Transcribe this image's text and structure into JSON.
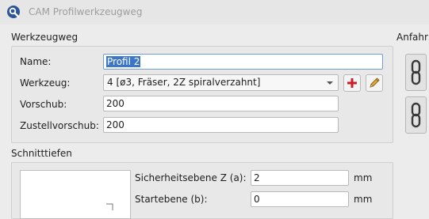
{
  "window": {
    "title": "CAM Profilwerkzeugweg"
  },
  "toolpath_group": {
    "title": "Werkzeugweg",
    "name_label": "Name:",
    "name_value": "Profil 2",
    "tool_label": "Werkzeug:",
    "tool_value": "4 [ø3, Fräser, 2Z spiralverzahnt]",
    "feed_label": "Vorschub:",
    "feed_value": "200",
    "plunge_label": "Zustellvorschub:",
    "plunge_value": "200"
  },
  "depth_group": {
    "title": "Schnitttiefen",
    "safety_label": "Sicherheitsebene Z (a):",
    "safety_value": "2",
    "safety_unit": "mm",
    "start_label": "Startebene (b):",
    "start_value": "0",
    "start_unit": "mm"
  },
  "side_panel": {
    "title": "Anfahr"
  },
  "icons": {
    "app": "qcad-cam-icon",
    "add_tool": "plus-icon",
    "edit_tool": "pencil-icon",
    "chain": "chain-link-icon",
    "combo": "chevron-down-icon"
  },
  "colors": {
    "selection": "#3b76c8",
    "add_icon": "#c8202a",
    "pencil": "#d59a1f"
  }
}
